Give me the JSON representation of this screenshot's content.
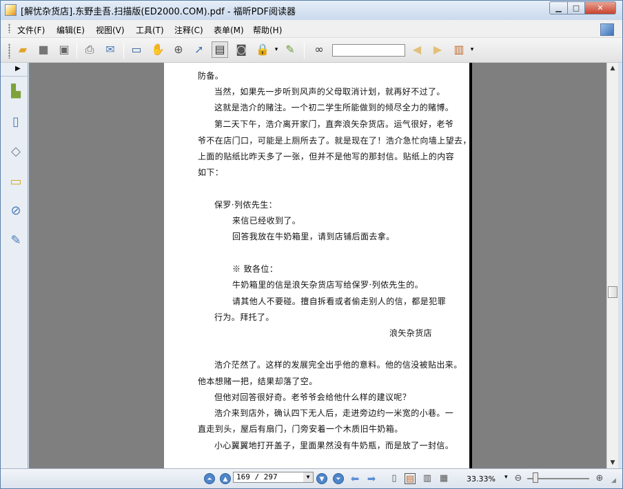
{
  "window": {
    "title": "[解忧杂货店].东野圭吾.扫描版(ED2000.COM).pdf - 福昕PDF阅读器",
    "minimize": "▁",
    "maximize": "□",
    "close": "✕"
  },
  "menu": [
    "文件(F)",
    "编辑(E)",
    "视图(V)",
    "工具(T)",
    "注释(C)",
    "表单(M)",
    "帮助(H)"
  ],
  "toolbar": {
    "search_placeholder": "",
    "search_value": "",
    "icons": [
      "open-icon",
      "save-icon",
      "save-as-icon",
      "print-icon",
      "email-icon",
      "fullscreen-icon",
      "hand-tool-icon",
      "zoom-tool-icon",
      "select-tool-icon",
      "text-select-icon",
      "snapshot-icon",
      "rms-icon",
      "sign-icon",
      "binoculars-icon",
      "prev-result-icon",
      "next-result-icon",
      "find-options-icon"
    ]
  },
  "page_text": [
    "防备。",
    "当然，如果先一步听到风声的父母取消计划，就再好不过了。",
    "这就是浩介的赌注。一个初二学生所能做到的倾尽全力的赌博。",
    "第二天下午，浩介离开家门，直奔浪矢杂货店。运气很好，老爷",
    "爷不在店门口，可能是上厕所去了。就是现在了！浩介急忙向墙上望去，",
    "上面的贴纸比昨天多了一张，但并不是他写的那封信。贴纸上的内容",
    "如下：",
    "保罗·列侬先生：",
    "来信已经收到了。",
    "回答我放在牛奶箱里，请到店铺后面去拿。",
    "※ 致各位：",
    "牛奶箱里的信是浪矢杂货店写给保罗·列侬先生的。",
    "请其他人不要碰。擅自拆看或者偷走别人的信，都是犯罪",
    "行为。拜托了。",
    "浪矢杂货店",
    "浩介茫然了。这样的发展完全出乎他的意料。他的信没被贴出来。",
    "他本想赌一把，结果却落了空。",
    "但他对回答很好奇。老爷爷会给他什么样的建议呢？",
    "浩介来到店外，确认四下无人后，走进旁边约一米宽的小巷。一",
    "直走到头，屋后有扇门，门旁安着一个木质旧牛奶箱。",
    "小心翼翼地打开盖子，里面果然没有牛奶瓶，而是放了一封信。"
  ],
  "status": {
    "page_field": "169 / 297",
    "zoom": "33.33%"
  }
}
